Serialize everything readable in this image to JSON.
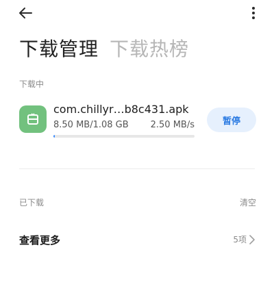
{
  "header": {
    "back_icon": "back-arrow-icon",
    "menu_icon": "more-vertical-icon"
  },
  "tabs": [
    {
      "label": "下载管理",
      "active": true
    },
    {
      "label": "下载热榜",
      "active": false
    }
  ],
  "downloading": {
    "section_label": "下载中",
    "items": [
      {
        "icon": "app-file-icon",
        "icon_color": "#72c17e",
        "name": "com.chillyr…b8c431.apk",
        "size": "8.50 MB/1.08 GB",
        "speed": "2.50 MB/s",
        "progress": 0.008,
        "action_label": "暂停"
      }
    ]
  },
  "downloaded": {
    "section_label": "已下载",
    "clear_label": "清空",
    "more_label": "查看更多",
    "more_count": "5项"
  },
  "colors": {
    "accent": "#2a7ae2",
    "pause_bg": "#e6f0fd",
    "progress": "#3a8bff"
  }
}
